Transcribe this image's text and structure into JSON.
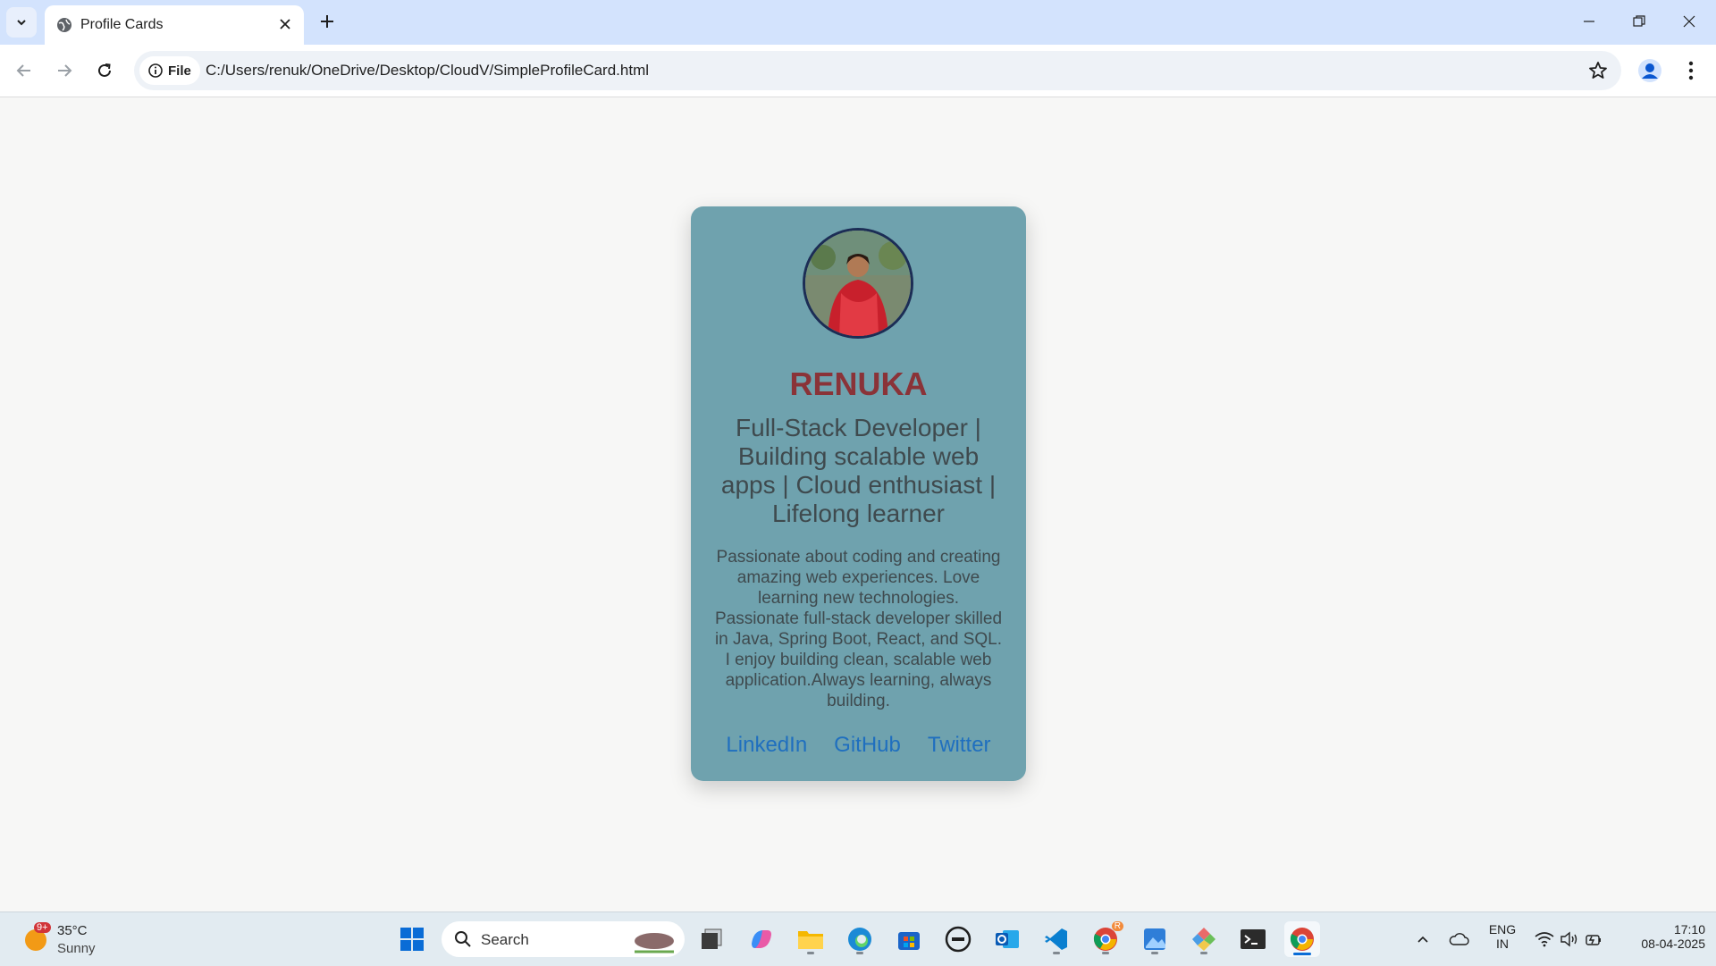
{
  "browser": {
    "tab_title": "Profile Cards",
    "site_chip": "File",
    "url": "C:/Users/renuk/OneDrive/Desktop/CloudV/SimpleProfileCard.html"
  },
  "profile": {
    "name": "RENUKA",
    "headline": "Full-Stack Developer | Building scalable web apps | Cloud enthusiast | Lifelong learner",
    "bio": "Passionate about coding and creating amazing web experiences. Love learning new technologies. Passionate full-stack developer skilled in Java, Spring Boot, React, and SQL. I enjoy building clean, scalable web application.Always learning, always building.",
    "links": [
      "LinkedIn",
      "GitHub",
      "Twitter"
    ]
  },
  "taskbar": {
    "weather_badge": "9+",
    "weather_temp": "35°C",
    "weather_cond": "Sunny",
    "search_label": "Search",
    "chrome_badge": "R",
    "lang_top": "ENG",
    "lang_bottom": "IN",
    "time": "17:10",
    "date": "08-04-2025"
  },
  "colors": {
    "card": "#6fa2ae",
    "name": "#8a3338",
    "link": "#1f6fbf",
    "tabstrip": "#d3e3fd"
  }
}
